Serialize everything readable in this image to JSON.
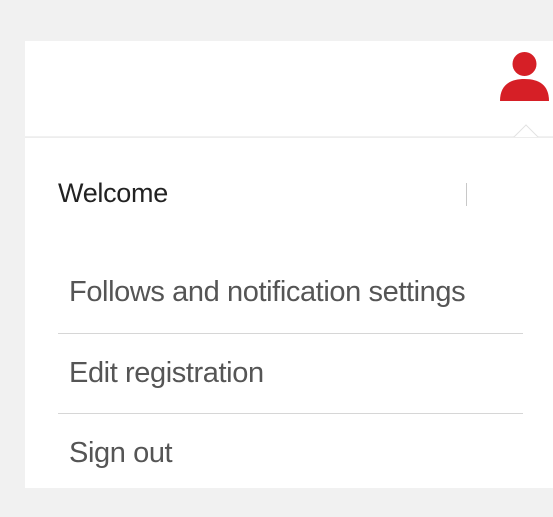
{
  "header": {
    "user_icon": "user-icon",
    "accent_color": "#d61f26"
  },
  "menu": {
    "welcome": "Welcome",
    "items": [
      {
        "label": "Follows and notification settings"
      },
      {
        "label": "Edit registration"
      },
      {
        "label": "Sign out"
      }
    ]
  }
}
